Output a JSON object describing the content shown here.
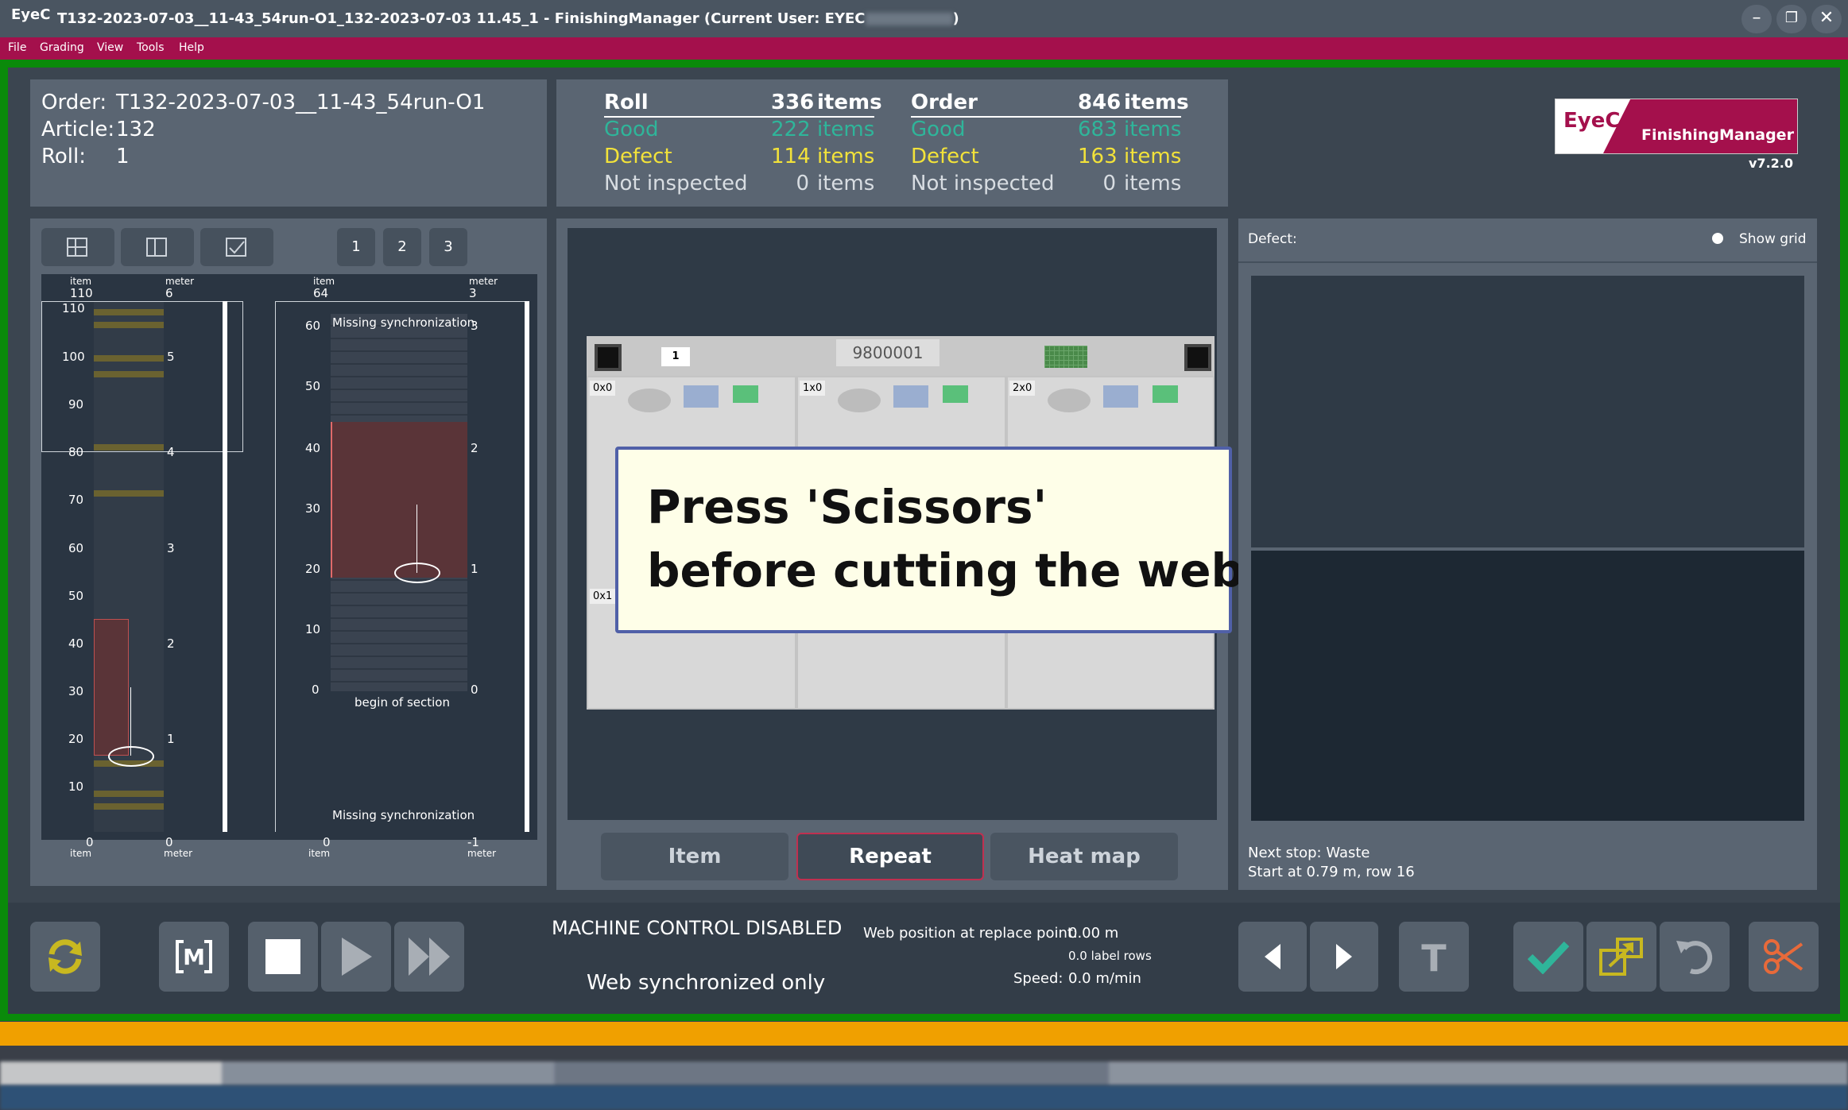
{
  "app": {
    "logo": "EyeC",
    "window_title": "T132-2023-07-03__11-43_54run-O1_132-2023-07-03 11.45_1  -  FinishingManager    (Current User: EYEC",
    "window_title_end": ")"
  },
  "menu": [
    "File",
    "Grading",
    "View",
    "Tools",
    "Help"
  ],
  "info": {
    "order_label": "Order:",
    "order_value": "T132-2023-07-03__11-43_54run-O1",
    "article_label": "Article:",
    "article_value": "132",
    "roll_label": "Roll:",
    "roll_value": "1"
  },
  "stats": {
    "roll": {
      "title": "Roll",
      "total": "336",
      "good": "222",
      "defect": "114",
      "not_inspected": "0"
    },
    "order": {
      "title": "Order",
      "total": "846",
      "good": "683",
      "defect": "163",
      "not_inspected": "0"
    },
    "items_label": "items",
    "good_label": "Good",
    "defect_label": "Defect",
    "not_inspected_label": "Not inspected"
  },
  "brand": {
    "eyec": "EyeC",
    "product": "FinishingManager",
    "version": "v7.2.0"
  },
  "roll_view": {
    "page_buttons": [
      "1",
      "2",
      "3"
    ],
    "left_item_header": "item",
    "left_item_max": "110",
    "left_meter_header": "meter",
    "left_meter_max": "6",
    "left_ticks": [
      "110",
      "100",
      "90",
      "80",
      "70",
      "60",
      "50",
      "40",
      "30",
      "20",
      "10"
    ],
    "left_meter_ticks": [
      "5",
      "4",
      "3",
      "2",
      "1"
    ],
    "left_foot_item_value": "0",
    "left_foot_item_label": "item",
    "left_foot_meter_value": "0",
    "left_foot_meter_label": "meter",
    "right_item_header": "item",
    "right_item_max": "64",
    "right_meter_header": "meter",
    "right_meter_max": "3",
    "right_ticks": [
      "60",
      "50",
      "40",
      "30",
      "20",
      "10",
      "0"
    ],
    "right_meter_ticks": [
      "3",
      "2",
      "1",
      "0"
    ],
    "missing_sync_top": "Missing synchronization",
    "begin_section": "begin of section",
    "missing_sync_bottom": "Missing synchronization",
    "right_foot_item_value": "0",
    "right_foot_item_label": "item",
    "right_foot_meter_value": "-1",
    "right_foot_meter_label": "meter"
  },
  "layout_view": {
    "sheet_number": "1",
    "barcode": "9800001",
    "cells": [
      "0x0",
      "1x0",
      "2x0",
      "0x1"
    ]
  },
  "popup": {
    "line1": "Press 'Scissors'",
    "line2": "before cutting the web!"
  },
  "view_tabs": {
    "item": "Item",
    "repeat": "Repeat",
    "heatmap": "Heat map"
  },
  "defect_panel": {
    "label": "Defect:",
    "show_grid": "Show grid",
    "next_stop": "Next stop: Waste",
    "start_at": "Start at 0.79 m, row 16"
  },
  "machine": {
    "status": "MACHINE CONTROL DISABLED",
    "mode": "Web synchronized only",
    "web_pos_label": "Web position at replace point:",
    "web_pos_value": "0.00 m",
    "label_rows": "0.0 label rows",
    "speed_label": "Speed:",
    "speed_value": "0.0 m/min"
  },
  "colors": {
    "good": "#2fb59a",
    "defect": "#f2e23a",
    "menu": "#a4104c",
    "frame": "#0a8a0a",
    "status": "#f0a000",
    "scissors": "#e86a3a",
    "check": "#2fb59a"
  },
  "icons": [
    "sync-icon",
    "manual-mode-icon",
    "stop-icon",
    "play-icon",
    "fast-forward-icon",
    "prev-icon",
    "next-icon",
    "text-icon",
    "check-icon",
    "export-icon",
    "undo-icon",
    "scissors-icon"
  ]
}
